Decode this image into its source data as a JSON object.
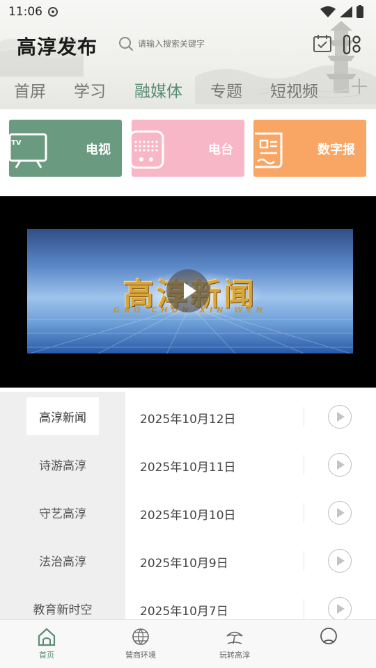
{
  "status": {
    "time": "11:06"
  },
  "header": {
    "app_title": "高淳发布",
    "search_placeholder": "请输入搜索关键字"
  },
  "tabs": [
    {
      "label": "首屏",
      "active": false
    },
    {
      "label": "学习",
      "active": false
    },
    {
      "label": "融媒体",
      "active": true
    },
    {
      "label": "专题",
      "active": false
    },
    {
      "label": "短视频",
      "active": false
    }
  ],
  "quick_links": [
    {
      "label": "电视",
      "icon": "tv-icon",
      "color": "#6a9a80"
    },
    {
      "label": "电台",
      "icon": "radio-icon",
      "color": "#f8b7c7"
    },
    {
      "label": "数字报",
      "icon": "newspaper-icon",
      "color": "#f9a564"
    }
  ],
  "video": {
    "title": "高淳新闻",
    "pinyin": "GAO CHUN XIN WEN"
  },
  "categories": [
    {
      "label": "高淳新闻",
      "active": true
    },
    {
      "label": "诗游高淳",
      "active": false
    },
    {
      "label": "守艺高淳",
      "active": false
    },
    {
      "label": "法治高淳",
      "active": false
    },
    {
      "label": "教育新时空",
      "active": false
    }
  ],
  "episodes": [
    {
      "date": "2025年10月12日"
    },
    {
      "date": "2025年10月11日"
    },
    {
      "date": "2025年10月10日"
    },
    {
      "date": "2025年10月9日"
    },
    {
      "date": "2025年10月7日"
    }
  ],
  "bottom_nav": [
    {
      "label": "首页",
      "icon": "home-icon",
      "active": true
    },
    {
      "label": "营商环境",
      "icon": "globe-icon",
      "active": false
    },
    {
      "label": "玩转高淳",
      "icon": "umbrella-icon",
      "active": false
    },
    {
      "label": "",
      "icon": "profile-icon",
      "active": false
    }
  ],
  "colors": {
    "accent": "#5a8d74",
    "tv": "#6a9a80",
    "radio": "#f8b7c7",
    "paper": "#f9a564"
  }
}
